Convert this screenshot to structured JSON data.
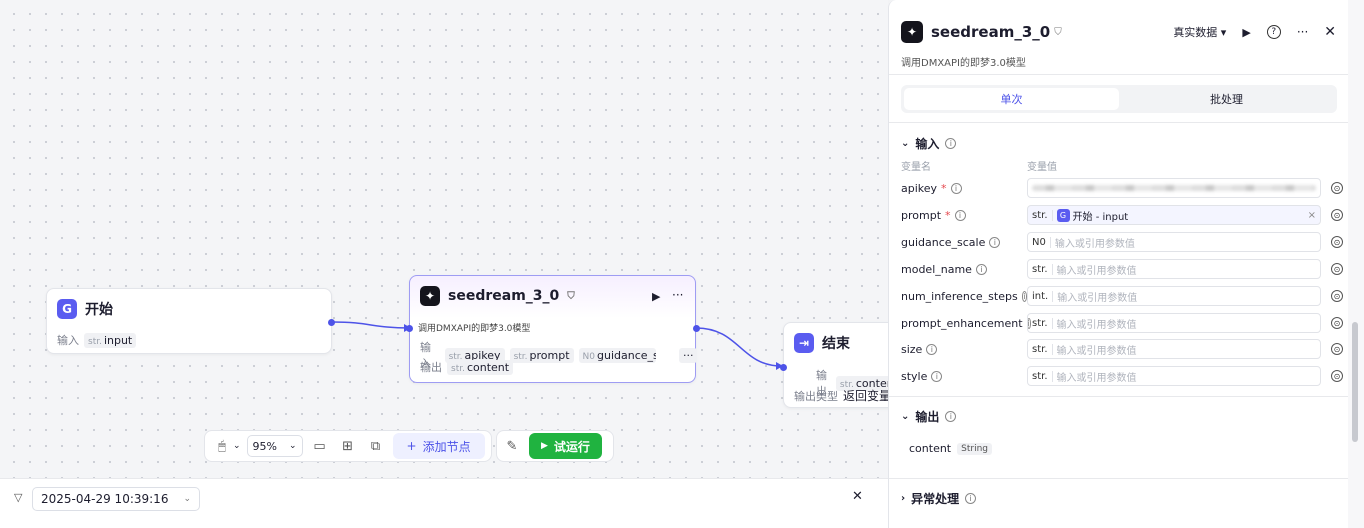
{
  "canvas": {
    "start_node": {
      "title": "开始",
      "input_label": "输入",
      "input_type": "str.",
      "input_name": "input"
    },
    "seedream_node": {
      "title": "seedream_3_0",
      "desc": "调用DMXAPI的即梦3.0模型",
      "input_label": "输入",
      "inputs": [
        {
          "type": "str.",
          "name": "apikey"
        },
        {
          "type": "str.",
          "name": "prompt"
        },
        {
          "type": "N0",
          "name": "guidance_scale"
        }
      ],
      "more": "···",
      "output_label": "输出",
      "output_type": "str.",
      "output_name": "content"
    },
    "end_node": {
      "title": "结束",
      "output_label": "输出",
      "output_type": "str.",
      "output_name": "content",
      "output_kind_label": "输出类型",
      "output_kind_value": "返回变量"
    }
  },
  "toolbar": {
    "zoom": "95%",
    "add_node": "添加节点",
    "run": "试运行"
  },
  "bottombar": {
    "datetime": "2025-04-29 10:39:16",
    "close": "✕"
  },
  "panel": {
    "title": "seedream_3_0",
    "desc": "调用DMXAPI的即梦3.0模型",
    "data_mode": "真实数据",
    "tabs": [
      "单次",
      "批处理"
    ],
    "input_section": "输入",
    "col_name": "变量名",
    "col_value": "变量值",
    "ref_type": "str.",
    "ref_label": "开始 - input",
    "params": [
      {
        "name": "apikey",
        "required": "*",
        "type": "",
        "placeholder": ""
      },
      {
        "name": "prompt",
        "required": "*",
        "type": "str.",
        "placeholder": ""
      },
      {
        "name": "guidance_scale",
        "required": "",
        "type": "N0",
        "placeholder": "输入或引用参数值"
      },
      {
        "name": "model_name",
        "required": "",
        "type": "str.",
        "placeholder": "输入或引用参数值"
      },
      {
        "name": "num_inference_steps",
        "required": "",
        "type": "int.",
        "placeholder": "输入或引用参数值"
      },
      {
        "name": "prompt_enhancement",
        "required": "",
        "type": "str.",
        "placeholder": "输入或引用参数值"
      },
      {
        "name": "size",
        "required": "",
        "type": "str.",
        "placeholder": "输入或引用参数值"
      },
      {
        "name": "style",
        "required": "",
        "type": "str.",
        "placeholder": "输入或引用参数值"
      }
    ],
    "output_section": "输出",
    "output_name": "content",
    "output_type": "String",
    "error_section": "异常处理"
  }
}
